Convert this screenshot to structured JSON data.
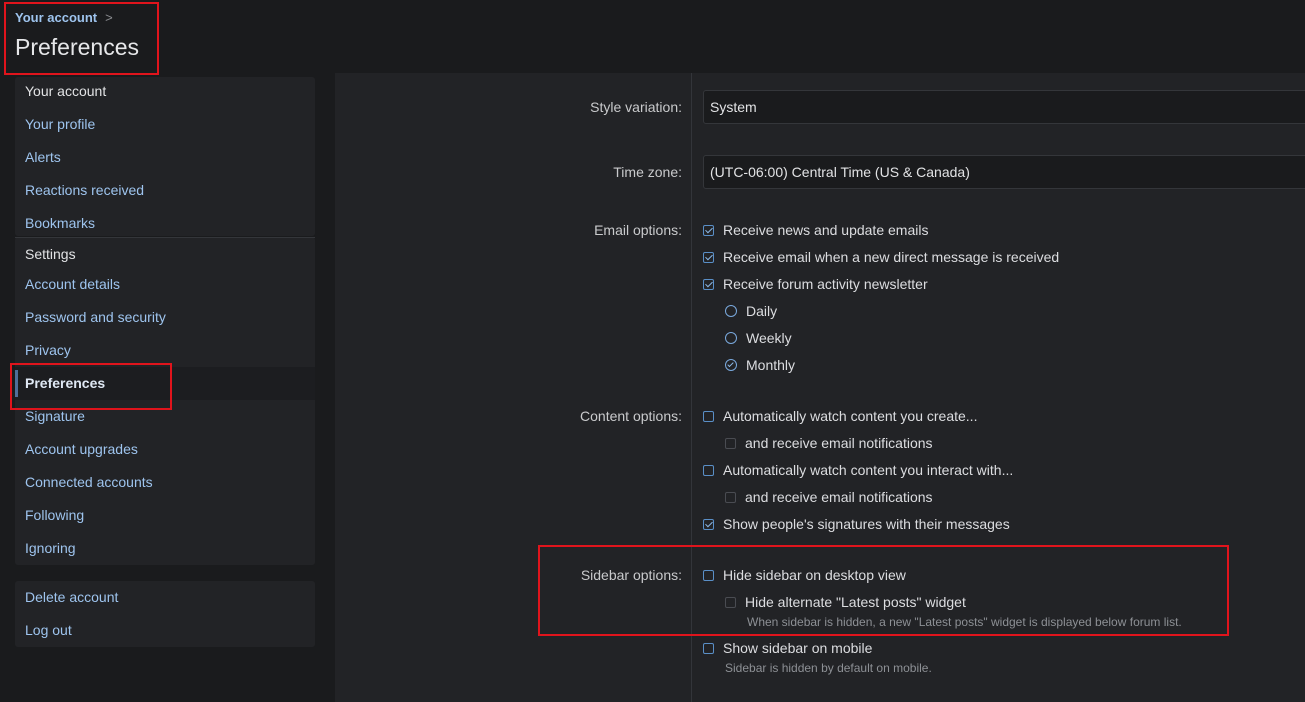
{
  "breadcrumb": {
    "link": "Your account",
    "separator": ">"
  },
  "page_title": "Preferences",
  "sidebar": {
    "account_group": {
      "heading": "Your account",
      "items": [
        "Your profile",
        "Alerts",
        "Reactions received",
        "Bookmarks"
      ]
    },
    "settings_group": {
      "heading": "Settings",
      "items": [
        "Account details",
        "Password and security",
        "Privacy",
        "Preferences",
        "Signature",
        "Account upgrades",
        "Connected accounts",
        "Following",
        "Ignoring"
      ],
      "active": "Preferences"
    },
    "actions": [
      "Delete account",
      "Log out"
    ]
  },
  "form": {
    "style_variation": {
      "label": "Style variation:",
      "value": "System"
    },
    "time_zone": {
      "label": "Time zone:",
      "value": "(UTC-06:00) Central Time (US & Canada)"
    },
    "email_options": {
      "label": "Email options:",
      "news": {
        "text": "Receive news and update emails",
        "checked": true
      },
      "direct_message": {
        "text": "Receive email when a new direct message is received",
        "checked": true
      },
      "newsletter": {
        "text": "Receive forum activity newsletter",
        "checked": true
      },
      "frequency": {
        "options": [
          "Daily",
          "Weekly",
          "Monthly"
        ],
        "selected": "Monthly"
      }
    },
    "content_options": {
      "label": "Content options:",
      "watch_create": {
        "text": "Automatically watch content you create...",
        "checked": false
      },
      "watch_create_email": {
        "text": "and receive email notifications",
        "checked": false
      },
      "watch_interact": {
        "text": "Automatically watch content you interact with...",
        "checked": false
      },
      "watch_interact_email": {
        "text": "and receive email notifications",
        "checked": false
      },
      "signatures": {
        "text": "Show people's signatures with their messages",
        "checked": true
      }
    },
    "sidebar_options": {
      "label": "Sidebar options:",
      "hide_desktop": {
        "text": "Hide sidebar on desktop view",
        "checked": false
      },
      "hide_latest": {
        "text": "Hide alternate \"Latest posts\" widget",
        "checked": false,
        "hint": "When sidebar is hidden, a new \"Latest posts\" widget is displayed below forum list."
      },
      "show_mobile": {
        "text": "Show sidebar on mobile",
        "checked": false,
        "hint": "Sidebar is hidden by default on mobile."
      }
    }
  },
  "colors": {
    "accent": "#9ec4ee",
    "highlight": "#e0141c",
    "background": "#1a1b1d",
    "panel": "#222326"
  }
}
